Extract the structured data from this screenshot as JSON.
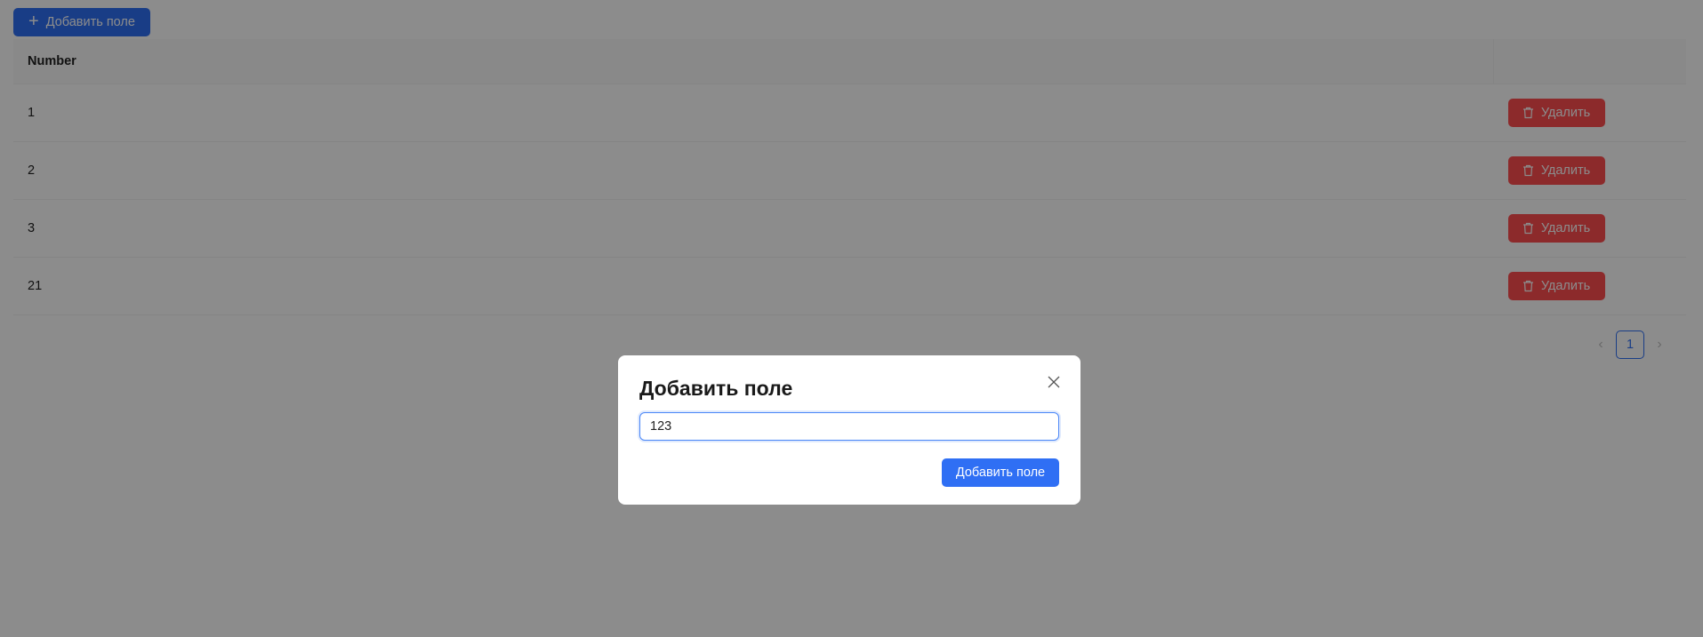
{
  "toolbar": {
    "add_label": "Добавить поле",
    "plus_icon": "+"
  },
  "table": {
    "columns": [
      "Number",
      ""
    ],
    "rows": [
      {
        "number": "1",
        "delete_label": "Удалить"
      },
      {
        "number": "2",
        "delete_label": "Удалить"
      },
      {
        "number": "3",
        "delete_label": "Удалить"
      },
      {
        "number": "21",
        "delete_label": "Удалить"
      }
    ]
  },
  "pagination": {
    "prev": "‹",
    "current": "1",
    "next": "›"
  },
  "modal": {
    "title": "Добавить поле",
    "input_value": "123",
    "submit_label": "Добавить поле"
  },
  "colors": {
    "primary": "#2f6ff4",
    "danger": "#ff4d4f",
    "overlay": "rgba(0,0,0,0.45)"
  }
}
